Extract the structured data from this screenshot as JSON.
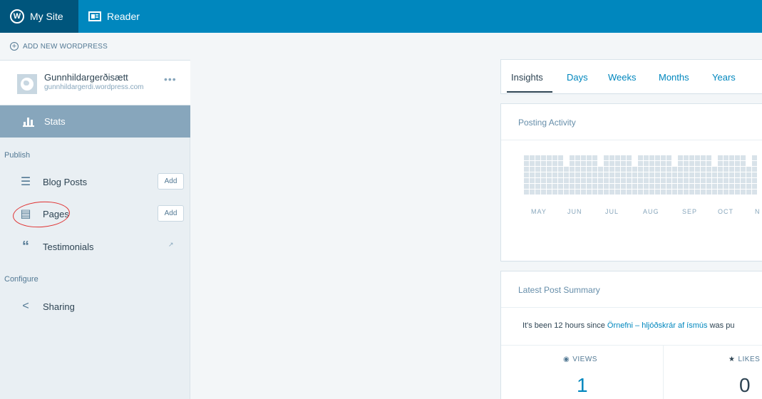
{
  "masterbar": {
    "my_site": "My Site",
    "reader": "Reader",
    "accent": "#0087be"
  },
  "sidebar": {
    "add_new": "ADD NEW WORDPRESS",
    "site": {
      "title": "Gunnhildargerðisætt",
      "url": "gunnhildargerdi.wordpress.com",
      "more": "•••"
    },
    "stats_label": "Stats",
    "sections": {
      "publish": "Publish",
      "configure": "Configure"
    },
    "items": {
      "blog_posts": {
        "label": "Blog Posts",
        "action": "Add",
        "icon": "posts-icon"
      },
      "pages": {
        "label": "Pages",
        "action": "Add",
        "icon": "page-icon"
      },
      "testimonials": {
        "label": "Testimonials",
        "icon": "quote-icon"
      },
      "sharing": {
        "label": "Sharing",
        "icon": "share-icon"
      }
    }
  },
  "tabs": [
    "Insights",
    "Days",
    "Weeks",
    "Months",
    "Years"
  ],
  "posting_activity": {
    "title": "Posting Activity",
    "months": [
      "MAY",
      "JUN",
      "JUL",
      "AUG",
      "SEP",
      "OCT",
      "N"
    ]
  },
  "latest_post": {
    "title": "Latest Post Summary",
    "text_before": "It's been 12 hours since ",
    "post_link": "Örnefni – hljóðskrár af ísmús",
    "text_after": " was pu",
    "views_label": "VIEWS",
    "views_value": "1",
    "likes_label": "LIKES",
    "likes_value": "0"
  }
}
